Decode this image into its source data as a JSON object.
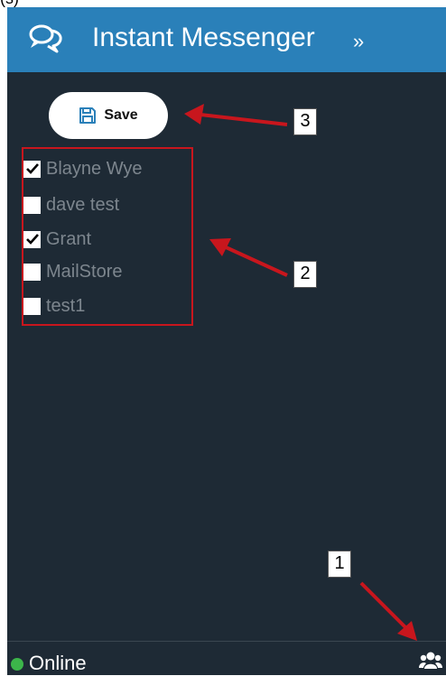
{
  "header": {
    "title": "Instant Messenger",
    "expand_glyph": "»",
    "chat_icon": "chat-bubbles-icon",
    "background": "#2a80b9"
  },
  "toolbar": {
    "save_label": "Save",
    "save_icon": "floppy-disk-icon"
  },
  "contacts": [
    {
      "label": "Blayne Wye",
      "checked": true
    },
    {
      "label": "dave test",
      "checked": false
    },
    {
      "label": "Grant",
      "checked": true
    },
    {
      "label": "MailStore",
      "checked": false
    },
    {
      "label": "test1",
      "checked": false
    }
  ],
  "status": {
    "text": "Online",
    "dot_color": "#3cb54a",
    "users_icon": "users-icon"
  },
  "annotations": {
    "marker_1": "1",
    "marker_2": "2",
    "marker_3": "3",
    "arrow_color": "#c8161d",
    "box_color": "#c8161d"
  },
  "colors": {
    "panel_background": "#1e2a35",
    "contact_text": "#7d868e"
  }
}
